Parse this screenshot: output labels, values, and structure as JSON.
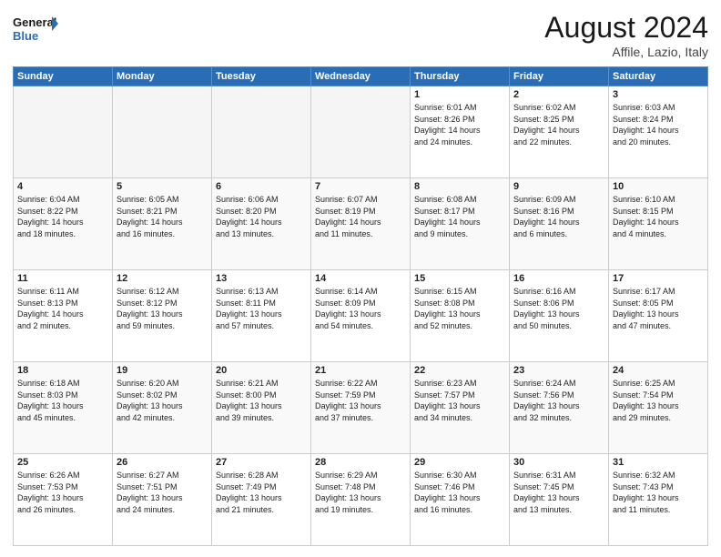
{
  "header": {
    "logo_line1": "General",
    "logo_line2": "Blue",
    "main_title": "August 2024",
    "subtitle": "Affile, Lazio, Italy"
  },
  "weekdays": [
    "Sunday",
    "Monday",
    "Tuesday",
    "Wednesday",
    "Thursday",
    "Friday",
    "Saturday"
  ],
  "weeks": [
    [
      {
        "day": "",
        "detail": ""
      },
      {
        "day": "",
        "detail": ""
      },
      {
        "day": "",
        "detail": ""
      },
      {
        "day": "",
        "detail": ""
      },
      {
        "day": "1",
        "detail": "Sunrise: 6:01 AM\nSunset: 8:26 PM\nDaylight: 14 hours\nand 24 minutes."
      },
      {
        "day": "2",
        "detail": "Sunrise: 6:02 AM\nSunset: 8:25 PM\nDaylight: 14 hours\nand 22 minutes."
      },
      {
        "day": "3",
        "detail": "Sunrise: 6:03 AM\nSunset: 8:24 PM\nDaylight: 14 hours\nand 20 minutes."
      }
    ],
    [
      {
        "day": "4",
        "detail": "Sunrise: 6:04 AM\nSunset: 8:22 PM\nDaylight: 14 hours\nand 18 minutes."
      },
      {
        "day": "5",
        "detail": "Sunrise: 6:05 AM\nSunset: 8:21 PM\nDaylight: 14 hours\nand 16 minutes."
      },
      {
        "day": "6",
        "detail": "Sunrise: 6:06 AM\nSunset: 8:20 PM\nDaylight: 14 hours\nand 13 minutes."
      },
      {
        "day": "7",
        "detail": "Sunrise: 6:07 AM\nSunset: 8:19 PM\nDaylight: 14 hours\nand 11 minutes."
      },
      {
        "day": "8",
        "detail": "Sunrise: 6:08 AM\nSunset: 8:17 PM\nDaylight: 14 hours\nand 9 minutes."
      },
      {
        "day": "9",
        "detail": "Sunrise: 6:09 AM\nSunset: 8:16 PM\nDaylight: 14 hours\nand 6 minutes."
      },
      {
        "day": "10",
        "detail": "Sunrise: 6:10 AM\nSunset: 8:15 PM\nDaylight: 14 hours\nand 4 minutes."
      }
    ],
    [
      {
        "day": "11",
        "detail": "Sunrise: 6:11 AM\nSunset: 8:13 PM\nDaylight: 14 hours\nand 2 minutes."
      },
      {
        "day": "12",
        "detail": "Sunrise: 6:12 AM\nSunset: 8:12 PM\nDaylight: 13 hours\nand 59 minutes."
      },
      {
        "day": "13",
        "detail": "Sunrise: 6:13 AM\nSunset: 8:11 PM\nDaylight: 13 hours\nand 57 minutes."
      },
      {
        "day": "14",
        "detail": "Sunrise: 6:14 AM\nSunset: 8:09 PM\nDaylight: 13 hours\nand 54 minutes."
      },
      {
        "day": "15",
        "detail": "Sunrise: 6:15 AM\nSunset: 8:08 PM\nDaylight: 13 hours\nand 52 minutes."
      },
      {
        "day": "16",
        "detail": "Sunrise: 6:16 AM\nSunset: 8:06 PM\nDaylight: 13 hours\nand 50 minutes."
      },
      {
        "day": "17",
        "detail": "Sunrise: 6:17 AM\nSunset: 8:05 PM\nDaylight: 13 hours\nand 47 minutes."
      }
    ],
    [
      {
        "day": "18",
        "detail": "Sunrise: 6:18 AM\nSunset: 8:03 PM\nDaylight: 13 hours\nand 45 minutes."
      },
      {
        "day": "19",
        "detail": "Sunrise: 6:20 AM\nSunset: 8:02 PM\nDaylight: 13 hours\nand 42 minutes."
      },
      {
        "day": "20",
        "detail": "Sunrise: 6:21 AM\nSunset: 8:00 PM\nDaylight: 13 hours\nand 39 minutes."
      },
      {
        "day": "21",
        "detail": "Sunrise: 6:22 AM\nSunset: 7:59 PM\nDaylight: 13 hours\nand 37 minutes."
      },
      {
        "day": "22",
        "detail": "Sunrise: 6:23 AM\nSunset: 7:57 PM\nDaylight: 13 hours\nand 34 minutes."
      },
      {
        "day": "23",
        "detail": "Sunrise: 6:24 AM\nSunset: 7:56 PM\nDaylight: 13 hours\nand 32 minutes."
      },
      {
        "day": "24",
        "detail": "Sunrise: 6:25 AM\nSunset: 7:54 PM\nDaylight: 13 hours\nand 29 minutes."
      }
    ],
    [
      {
        "day": "25",
        "detail": "Sunrise: 6:26 AM\nSunset: 7:53 PM\nDaylight: 13 hours\nand 26 minutes."
      },
      {
        "day": "26",
        "detail": "Sunrise: 6:27 AM\nSunset: 7:51 PM\nDaylight: 13 hours\nand 24 minutes."
      },
      {
        "day": "27",
        "detail": "Sunrise: 6:28 AM\nSunset: 7:49 PM\nDaylight: 13 hours\nand 21 minutes."
      },
      {
        "day": "28",
        "detail": "Sunrise: 6:29 AM\nSunset: 7:48 PM\nDaylight: 13 hours\nand 19 minutes."
      },
      {
        "day": "29",
        "detail": "Sunrise: 6:30 AM\nSunset: 7:46 PM\nDaylight: 13 hours\nand 16 minutes."
      },
      {
        "day": "30",
        "detail": "Sunrise: 6:31 AM\nSunset: 7:45 PM\nDaylight: 13 hours\nand 13 minutes."
      },
      {
        "day": "31",
        "detail": "Sunrise: 6:32 AM\nSunset: 7:43 PM\nDaylight: 13 hours\nand 11 minutes."
      }
    ]
  ]
}
